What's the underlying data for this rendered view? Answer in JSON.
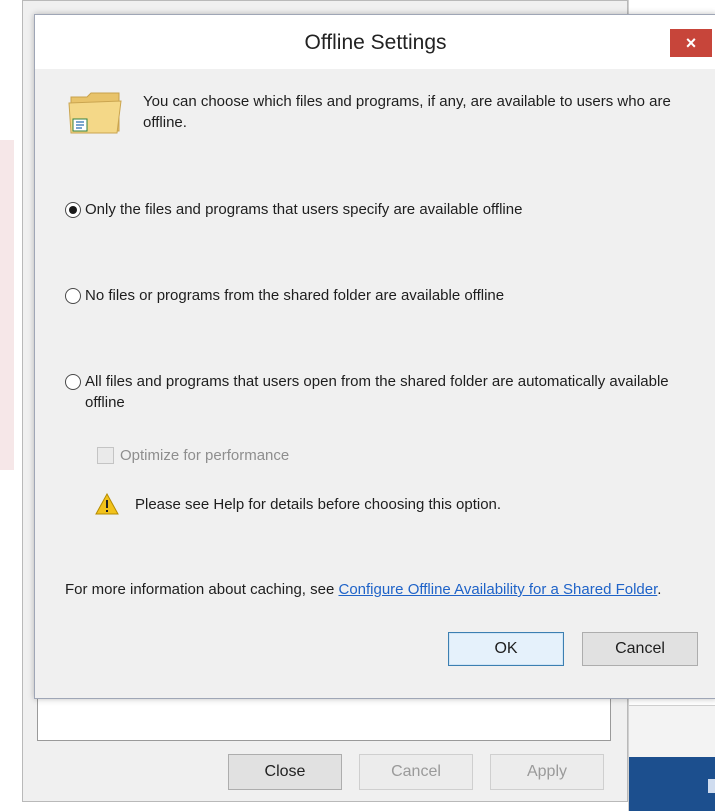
{
  "dialog": {
    "title": "Offline Settings",
    "close_label": "×",
    "intro": "You can choose which files and programs, if any, are available to users who are offline.",
    "options": [
      {
        "label": "Only the files and programs that users specify are available offline",
        "checked": true
      },
      {
        "label": "No files or programs from the shared folder are available offline",
        "checked": false
      },
      {
        "label": "All files and programs that users open from the shared folder are automatically available offline",
        "checked": false
      }
    ],
    "optimize_label": "Optimize for performance",
    "warning": "Please see Help for details before choosing this option.",
    "info_prefix": "For more information about caching, see ",
    "info_link": "Configure Offline Availability for a Shared Folder",
    "info_suffix": ".",
    "ok_label": "OK",
    "cancel_label": "Cancel"
  },
  "background_dialog": {
    "close_label": "Close",
    "cancel_label": "Cancel",
    "apply_label": "Apply"
  },
  "colors": {
    "close_button": "#c7453a",
    "link": "#1f63c8",
    "default_button_border": "#3c7fb1"
  }
}
